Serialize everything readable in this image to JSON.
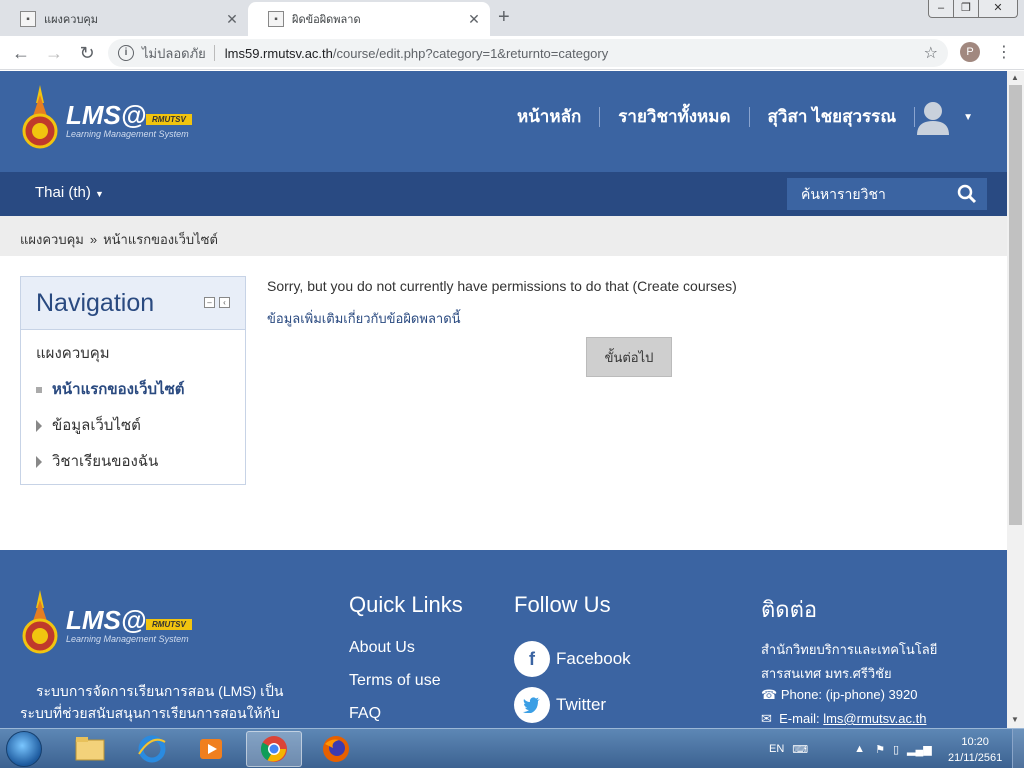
{
  "browser": {
    "tabs": [
      {
        "title": "แผงควบคุม",
        "active": false
      },
      {
        "title": "ผิดข้อผิดพลาด",
        "active": true
      }
    ],
    "address": {
      "security_label": "ไม่ปลอดภัย",
      "host": "lms59.rmutsv.ac.th",
      "path": "/course/edit.php?category=1&returnto=category"
    },
    "profile_initial": "P"
  },
  "header": {
    "logo_text": "LMS@",
    "logo_ribbon": "RMUTSV",
    "logo_subtitle": "Learning Management System",
    "nav": [
      "หน้าหลัก",
      "รายวิชาทั้งหมด",
      "สุวิสา ไชยสุวรรณ"
    ],
    "language": "Thai (th)",
    "search_placeholder": "ค้นหารายวิชา"
  },
  "breadcrumb": [
    "แผงควบคุม",
    "หน้าแรกของเว็บไซต์"
  ],
  "navigation": {
    "title": "Navigation",
    "items": [
      {
        "label": "แผงควบคุม",
        "type": "plain"
      },
      {
        "label": "หน้าแรกของเว็บไซต์",
        "type": "current"
      },
      {
        "label": "ข้อมูลเว็บไซต์",
        "type": "branch"
      },
      {
        "label": "วิชาเรียนของฉัน",
        "type": "branch"
      }
    ]
  },
  "main": {
    "error": "Sorry, but you do not currently have permissions to do that (Create courses)",
    "more_info": "ข้อมูลเพิ่มเติมเกี่ยวกับข้อผิดพลาดนี้",
    "continue_label": "ขั้นต่อไป"
  },
  "footer": {
    "about_text": "ระบบการจัดการเรียนการสอน (LMS) เป็นระบบที่ช่วยสนับสนุนการเรียนการสอนให้กับ",
    "quick_links_title": "Quick Links",
    "quick_links": [
      "About Us",
      "Terms of use",
      "FAQ"
    ],
    "follow_title": "Follow Us",
    "social": [
      "Facebook",
      "Twitter"
    ],
    "contact_title": "ติดต่อ",
    "contact_org_1": "สำนักวิทยบริการและเทคโนโลยี",
    "contact_org_2": "สารสนเทศ มทร.ศรีวิชัย",
    "contact_phone": "Phone: (ip-phone) 3920",
    "contact_email_label": "E-mail:",
    "contact_email": "lms@rmutsv.ac.th"
  },
  "taskbar": {
    "language": "EN",
    "time": "10:20",
    "date": "21/11/2561"
  }
}
